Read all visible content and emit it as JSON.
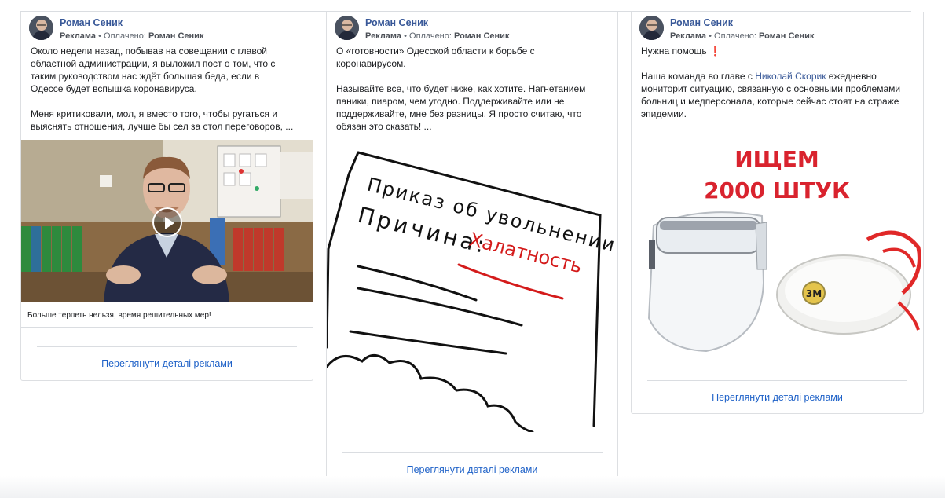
{
  "cards": [
    {
      "author": "Роман Сеник",
      "ad_label": "Реклама",
      "paid_label": "Оплачено:",
      "payer": "Роман Сеник",
      "text": "Около недели назад, побывав на совещании с главой\nобластной администрации, я выложил пост о том, что с\nтаким руководством нас ждёт большая беда, если в\nОдессе будет вспышка коронавируса.\n\nМеня критиковали, мол, я вместо того, чтобы ругаться и\nвыяснять отношения, лучше бы сел за стол переговоров, ...",
      "media_type": "video",
      "caption": "Больше терпеть нельзя, время решительных мер!",
      "details_link": "Переглянути деталі реклами"
    },
    {
      "author": "Роман Сеник",
      "ad_label": "Реклама",
      "paid_label": "Оплачено:",
      "payer": "Роман Сеник",
      "text": "О «готовности» Одесской области к борьбе с\nкоронавирусом.\n\nНазывайте все, что будет ниже, как хотите. Нагнетанием\nпаники, пиаром, чем угодно. Поддерживайте или не\nподдерживайте, мне без разницы. Я просто считаю, что\nобязан это сказать! ...",
      "media_type": "drawing",
      "drawing_line1": "Приказ об увольнении",
      "drawing_line2": "Причина:",
      "drawing_highlight": "Халатность",
      "details_link": "Переглянути деталі реклами"
    },
    {
      "author": "Роман Сеник",
      "ad_label": "Реклама",
      "paid_label": "Оплачено:",
      "payer": "Роман Сеник",
      "text_line1": "Нужна помощь",
      "text_line1_emoji": "❗",
      "text_prefix": "Наша команда во главе с ",
      "text_link": "Николай Скорик",
      "text_suffix": " ежедневно\nмониторит ситуацию, связанную с основными проблемами\nбольниц и медперсонала, которые сейчас стоят на страже\nэпидемии.",
      "media_type": "image",
      "image_title_line1": "ИЩЕМ",
      "image_title_line2": "2000 ШТУК",
      "mask_brand": "3M",
      "details_link": "Переглянути деталі реклами"
    }
  ],
  "colors": {
    "name": "#385898",
    "link": "#1f62c8",
    "accent_red": "#d9232e"
  }
}
